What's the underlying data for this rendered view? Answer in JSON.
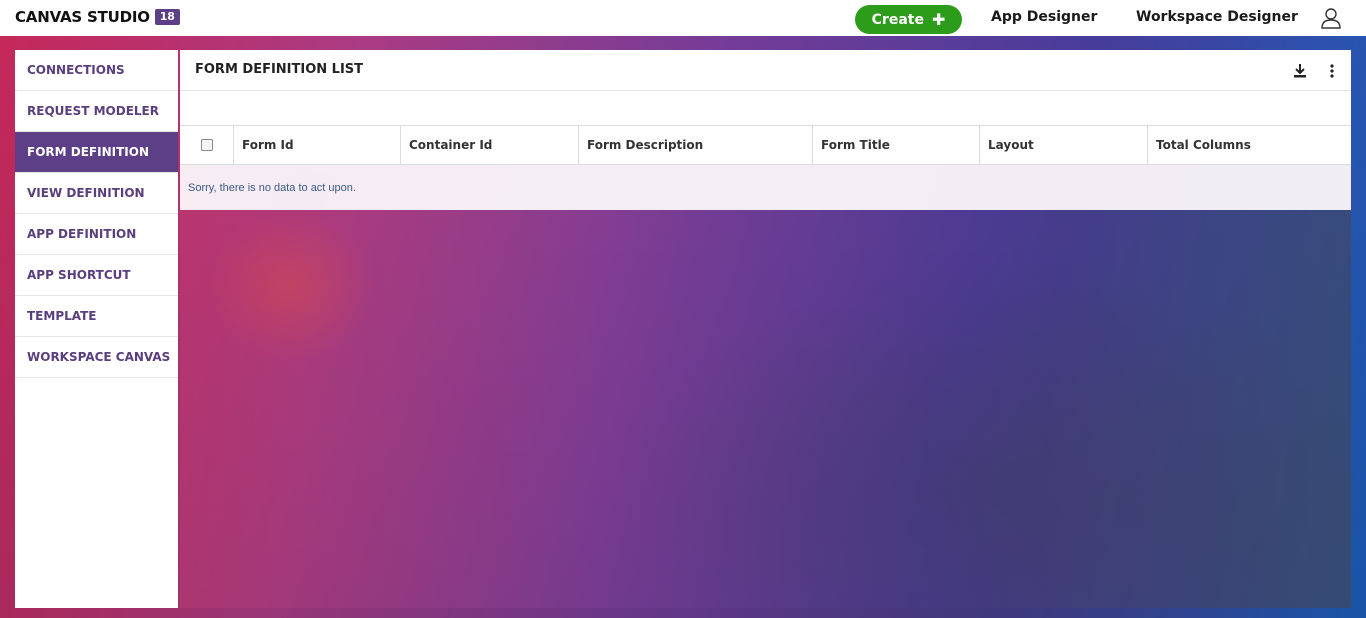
{
  "app": {
    "brand": "CANVAS STUDIO",
    "version": "18"
  },
  "topnav": {
    "create_label": "Create",
    "links": [
      "App Designer",
      "Workspace Designer"
    ]
  },
  "sidebar": {
    "items": [
      {
        "label": "CONNECTIONS"
      },
      {
        "label": "REQUEST MODELER"
      },
      {
        "label": "FORM DEFINITION"
      },
      {
        "label": "VIEW DEFINITION"
      },
      {
        "label": "APP DEFINITION"
      },
      {
        "label": "APP SHORTCUT"
      },
      {
        "label": "TEMPLATE"
      },
      {
        "label": "WORKSPACE CANVAS"
      }
    ],
    "active_index": 2
  },
  "panel": {
    "title": "FORM DEFINITION LIST",
    "columns": [
      "Form Id",
      "Container Id",
      "Form Description",
      "Form Title",
      "Layout",
      "Total Columns"
    ],
    "empty_message": "Sorry, there is no data to act upon."
  },
  "colors": {
    "accent": "#5c3f86",
    "create": "#2e9c1b"
  }
}
